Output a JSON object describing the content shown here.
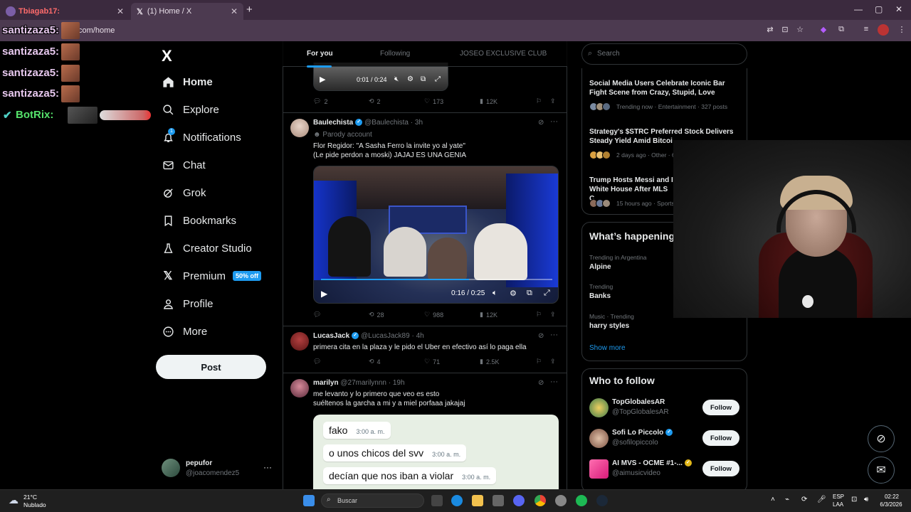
{
  "browser": {
    "tabs": [
      {
        "label": "Tbiagab17:",
        "close": "✕"
      },
      {
        "label": "(1) Home / X",
        "close": "✕"
      }
    ],
    "new_tab": "+",
    "url": "com/home",
    "window_controls": [
      "—",
      "▢",
      "✕"
    ]
  },
  "chat_overlay": [
    {
      "user": "santizaza5:"
    },
    {
      "user": "santizaza5:"
    },
    {
      "user": "santizaza5:"
    },
    {
      "user": "santizaza5:"
    },
    {
      "user": "BotRix:"
    }
  ],
  "nav": {
    "logo": "X",
    "items": [
      {
        "label": "Home",
        "icon": "home-icon"
      },
      {
        "label": "Explore",
        "icon": "search-icon"
      },
      {
        "label": "Notifications",
        "icon": "bell-icon",
        "badge": "1"
      },
      {
        "label": "Chat",
        "icon": "mail-icon"
      },
      {
        "label": "Grok",
        "icon": "grok-icon"
      },
      {
        "label": "Bookmarks",
        "icon": "bookmark-icon"
      },
      {
        "label": "Creator Studio",
        "icon": "flask-icon"
      },
      {
        "label": "Premium",
        "icon": "x-icon",
        "badge": "50% off"
      },
      {
        "label": "Profile",
        "icon": "person-icon"
      },
      {
        "label": "More",
        "icon": "more-icon"
      }
    ],
    "post": "Post",
    "account": {
      "name": "pepufor",
      "handle": "@joacomendez5",
      "more": "···"
    }
  },
  "timeline": {
    "tabs": {
      "for_you": "For you",
      "following": "Following",
      "club": "JOSEO EXCLUSIVE CLUB"
    },
    "top_video": {
      "time": "0:01 / 0:24"
    },
    "top_actions": {
      "replies": "2",
      "reposts": "2",
      "likes": "173",
      "views": "12K"
    },
    "tweets": [
      {
        "name": "Baulechista",
        "handle": "@Baulechista · 3h",
        "parody": "Parody account",
        "text1": "Flor Regidor: \"A Sasha Ferro la invite yo al yate\"",
        "text2": "(Le pide perdon a moski) JAJAJ ES UNA GENIA",
        "video_time": "0:16 / 0:25",
        "actions": {
          "replies": "",
          "reposts": "28",
          "likes": "988",
          "views": "12K"
        }
      },
      {
        "name": "LucasJack",
        "handle": "@LucasJack89 · 4h",
        "text1": "primera cita en la plaza y le pido el Uber en efectivo así lo paga ella",
        "actions": {
          "replies": "",
          "reposts": "4",
          "likes": "71",
          "views": "2.5K"
        }
      },
      {
        "name": "marilyn",
        "handle": "@27marilynnn · 19h",
        "text1": "me levanto y lo primero que veo es esto",
        "text2": "suéltenos la garcha a mi y a miel porfaaa jakajaj",
        "chat_bubbles": [
          {
            "text": "fako",
            "time": "3:00 a. m."
          },
          {
            "text": "o unos chicos del svv",
            "time": "3:00 a. m."
          },
          {
            "text": "decían que nos iban a violar",
            "time": "3:00 a. m."
          }
        ]
      }
    ]
  },
  "right": {
    "search_placeholder": "Search",
    "news": [
      {
        "title": "Social Media Users Celebrate Iconic Bar Fight Scene from Crazy, Stupid, Love",
        "meta": "Trending now · Entertainment · 327 posts"
      },
      {
        "title": "Strategy's $STRC Preferred Stock Delivers Steady Yield Amid Bitcoi",
        "meta": "2 days ago · Other · 6"
      },
      {
        "title": "Trump Hosts Messi and I White House After MLS C",
        "meta": "15 hours ago · Sports"
      }
    ],
    "whats_happening": "What’s happening",
    "trends": [
      {
        "category": "Trending in Argentina",
        "name": "Alpine"
      },
      {
        "category": "Trending",
        "name": "Banks"
      },
      {
        "category": "Music · Trending",
        "name": "harry styles"
      }
    ],
    "show_more": "Show more",
    "who_to_follow": "Who to follow",
    "follow": [
      {
        "name": "TopGlobalesAR",
        "handle": "@TopGlobalesAR",
        "button": "Follow"
      },
      {
        "name": "Sofi Lo Piccolo",
        "handle": "@sofilopiccolo",
        "button": "Follow"
      },
      {
        "name": "AI MVS - OCME #1-...",
        "handle": "@aimusicvideo",
        "button": "Follow"
      }
    ]
  },
  "taskbar": {
    "weather_temp": "21°C",
    "weather_desc": "Nublado",
    "search": "Buscar",
    "lang1": "ESP",
    "lang2": "LAA",
    "time": "02:22",
    "date": "6/3/2026"
  },
  "colors": {
    "accent": "#1d9bf0",
    "bg": "#000000",
    "border": "#2f3336",
    "muted": "#71767b"
  }
}
